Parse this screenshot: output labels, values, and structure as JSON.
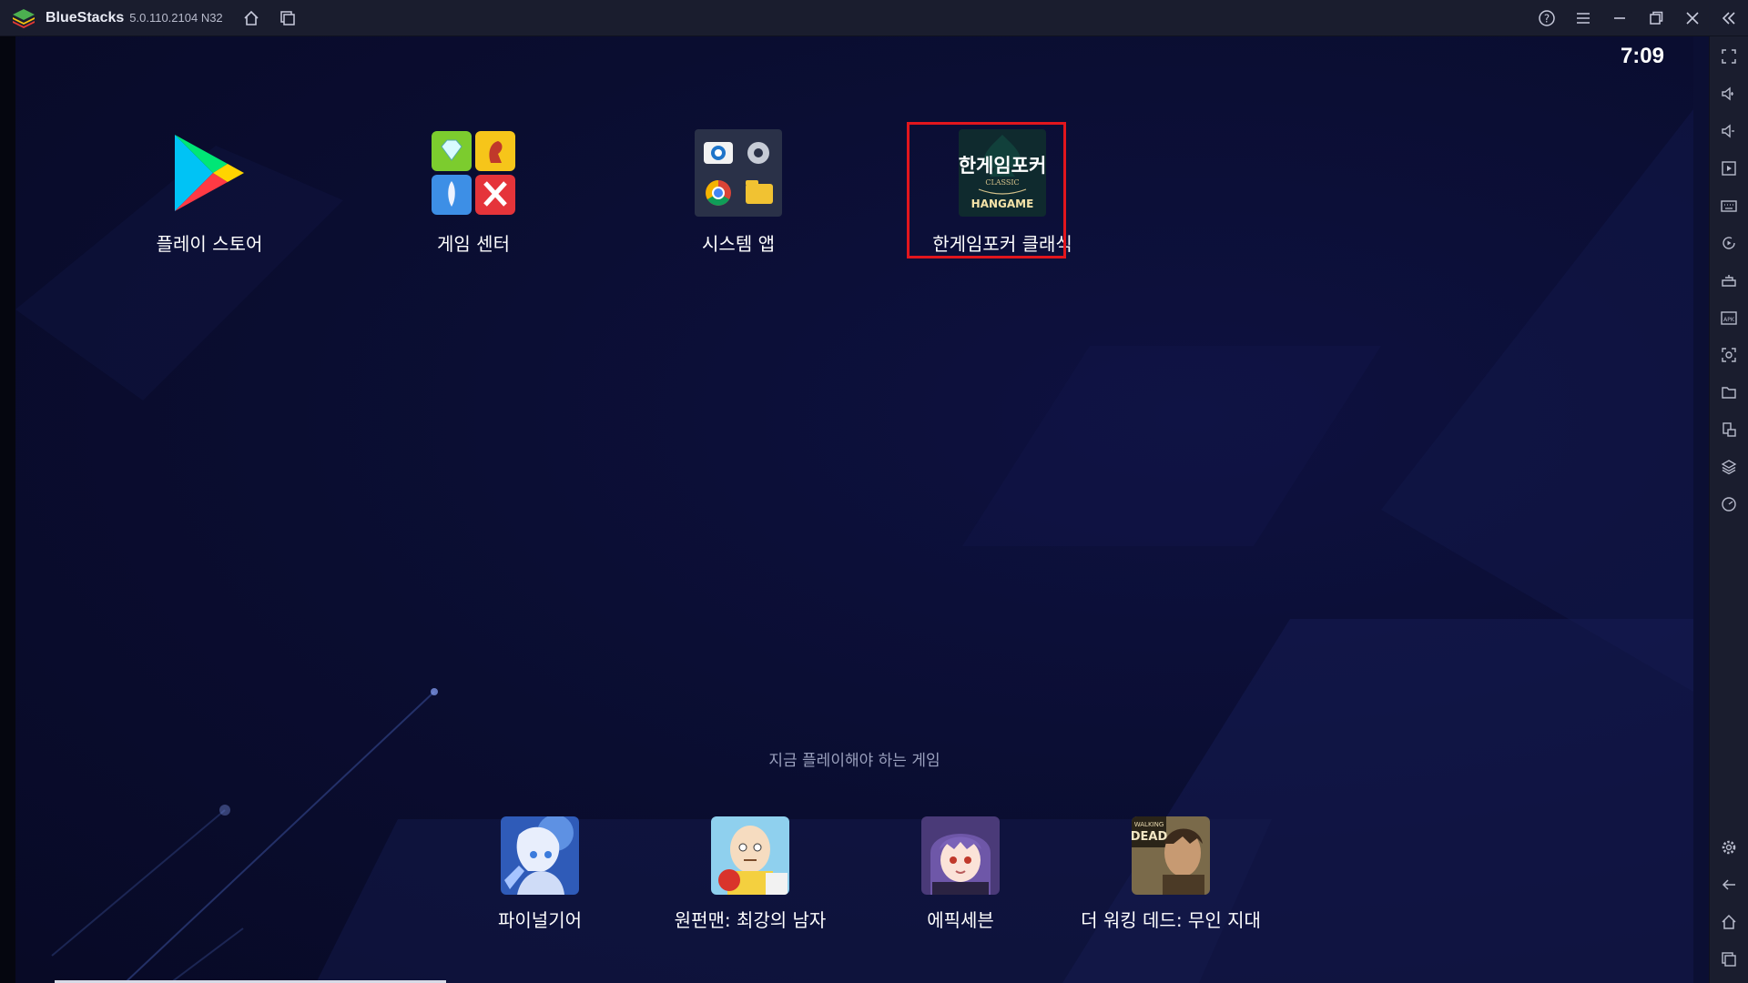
{
  "window": {
    "app_name": "BlueStacks",
    "version": "5.0.110.2104  N32",
    "controls": [
      "help-icon",
      "menu-icon",
      "minimize-icon",
      "restore-icon",
      "close-icon",
      "collapse-sidebar-icon"
    ]
  },
  "status": {
    "clock": "7:09"
  },
  "home_apps": [
    {
      "label": "플레이 스토어",
      "icon": "play-store-icon"
    },
    {
      "label": "게임 센터",
      "icon": "game-center-icon"
    },
    {
      "label": "시스템 앱",
      "icon": "system-apps-folder-icon"
    },
    {
      "label": "한게임포커 클래식",
      "icon": "hangame-poker-icon",
      "highlighted": true,
      "icon_text": {
        "title": "한게임포커",
        "sub": "CLASSIC",
        "brand": "HANGAME"
      }
    }
  ],
  "recommended": {
    "title": "지금 플레이해야 하는 게임",
    "games": [
      {
        "label": "파이널기어",
        "icon": "final-gear-icon"
      },
      {
        "label": "원펀맨: 최강의 남자",
        "icon": "one-punch-man-icon"
      },
      {
        "label": "에픽세븐",
        "icon": "epic-seven-icon"
      },
      {
        "label": "더 워킹 데드: 무인 지대",
        "icon": "walking-dead-icon",
        "icon_text": {
          "line1": "WALKING",
          "line2": "DEAD"
        }
      }
    ]
  },
  "sidebar_icons": [
    "fullscreen-icon",
    "volume-up-icon",
    "volume-down-icon",
    "media-icon",
    "keyboard-icon",
    "macro-icon",
    "game-controls-icon",
    "apk-install-icon",
    "screenshot-icon",
    "folder-icon",
    "multi-instance-icon",
    "layers-icon",
    "performance-icon",
    "settings-icon",
    "back-icon",
    "home-icon",
    "recent-apps-icon"
  ],
  "colors": {
    "titlebar": "#1a1d2e",
    "screen_bg": "#0b0f33",
    "highlight": "#e2161d"
  }
}
